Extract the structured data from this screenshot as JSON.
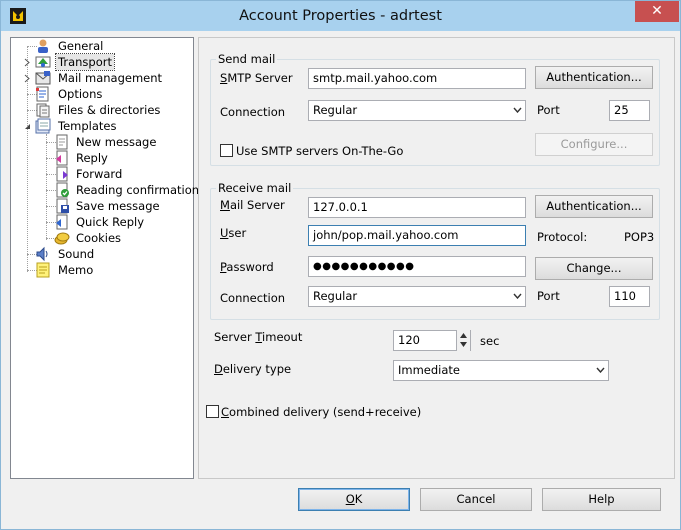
{
  "window": {
    "title": "Account Properties - adrtest",
    "close_glyph": "✕"
  },
  "tree": {
    "items": [
      {
        "label": "General",
        "icon": "person-icon"
      },
      {
        "label": "Transport",
        "icon": "transport-icon",
        "selected": true
      },
      {
        "label": "Mail management",
        "icon": "mail-management-icon"
      },
      {
        "label": "Options",
        "icon": "options-icon"
      },
      {
        "label": "Files & directories",
        "icon": "files-icon"
      },
      {
        "label": "Templates",
        "icon": "templates-icon"
      },
      {
        "label": "New message",
        "icon": "new-message-icon"
      },
      {
        "label": "Reply",
        "icon": "reply-icon"
      },
      {
        "label": "Forward",
        "icon": "forward-icon"
      },
      {
        "label": "Reading confirmation",
        "icon": "reading-confirmation-icon"
      },
      {
        "label": "Save message",
        "icon": "save-message-icon"
      },
      {
        "label": "Quick Reply",
        "icon": "quick-reply-icon"
      },
      {
        "label": "Cookies",
        "icon": "cookies-icon"
      },
      {
        "label": "Sound",
        "icon": "sound-icon"
      },
      {
        "label": "Memo",
        "icon": "memo-icon"
      }
    ]
  },
  "send": {
    "group_title": "Send mail",
    "smtp_label_u": "S",
    "smtp_label_rest": "MTP Server",
    "smtp_value": "smtp.mail.yahoo.com",
    "auth_button": "Authentication...",
    "connection_label": "Connection",
    "connection_value": "Regular",
    "port_label": "Port",
    "port_value": "25",
    "onthego_label": "Use SMTP servers On-The-Go",
    "onthego_checked": false,
    "configure_button": "Configure..."
  },
  "receive": {
    "group_title": "Receive mail",
    "server_label_u": "M",
    "server_label_rest": "ail Server",
    "server_value": "127.0.0.1",
    "auth_button": "Authentication...",
    "user_label_u": "U",
    "user_label_rest": "ser",
    "user_value": "john/pop.mail.yahoo.com",
    "protocol_label": "Protocol:",
    "protocol_value": "POP3",
    "password_label_u": "P",
    "password_label_rest": "assword",
    "password_value": "●●●●●●●●●●●",
    "change_button": "Change...",
    "connection_label": "Connection",
    "connection_value": "Regular",
    "port_label": "Port",
    "port_value": "110"
  },
  "timeout": {
    "label_pre": "Server ",
    "label_u": "T",
    "label_rest": "imeout",
    "value": "120",
    "unit": "sec"
  },
  "delivery": {
    "label_u": "D",
    "label_rest": "elivery type",
    "value": "Immediate"
  },
  "combined": {
    "label_u": "C",
    "label_rest": "ombined delivery (send+receive)",
    "checked": false
  },
  "footer": {
    "ok_u": "O",
    "ok_rest": "K",
    "cancel": "Cancel",
    "help": "Help"
  },
  "colors": {
    "titlebar": "#a8d1ee",
    "close": "#c75050",
    "focus_border": "#3c7fb1"
  }
}
